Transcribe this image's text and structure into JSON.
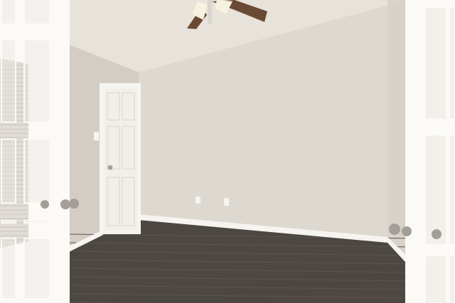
{
  "scene": {
    "description_visible_text": [],
    "palette": {
      "ceiling": "#e7e2da",
      "wall_back": "#ddd8d0",
      "wall_left": "#d3cdc4",
      "wall_right": "#d8d2ca",
      "floor": "#4d4741",
      "floor_plank": "#5c554e",
      "trim": "#f6f4f0",
      "door": "#f1efea",
      "french_door": "#fbfaf7",
      "glass": "#e9e6e0",
      "fan_blade": "#6b4a33",
      "fan_light": "#f7f1df",
      "knob": "#a39f98"
    },
    "icons": [
      "ceiling-fan-icon",
      "door-knob-icon",
      "outlet-icon",
      "light-switch-icon"
    ]
  }
}
